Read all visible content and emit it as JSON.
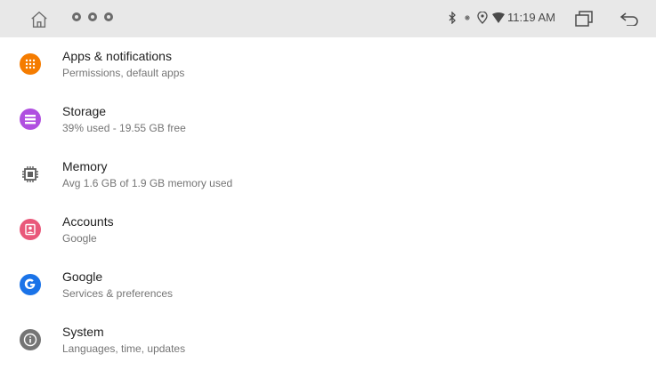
{
  "status_bar": {
    "time": "11:19 AM",
    "left_icons": [
      "home-icon",
      "notification-dot-icon",
      "notification-dot-icon",
      "notification-dot-icon"
    ],
    "right_icons": [
      "bluetooth-icon",
      "signal-icon",
      "location-icon",
      "wifi-icon",
      "recents-icon",
      "back-icon"
    ]
  },
  "settings_list": [
    {
      "title": "Apps & notifications",
      "subtitle": "Permissions, default apps",
      "icon": "apps-icon",
      "color": "#f57c00"
    },
    {
      "title": "Storage",
      "subtitle": "39% used - 19.55 GB free",
      "icon": "storage-icon",
      "color": "#b04fe0"
    },
    {
      "title": "Memory",
      "subtitle": "Avg 1.6 GB of 1.9 GB memory used",
      "icon": "memory-icon",
      "color": "#5f5f5f"
    },
    {
      "title": "Accounts",
      "subtitle": "Google",
      "icon": "accounts-icon",
      "color": "#e9587a"
    },
    {
      "title": "Google",
      "subtitle": "Services & preferences",
      "icon": "google-icon",
      "color": "#1a73e8"
    },
    {
      "title": "System",
      "subtitle": "Languages, time, updates",
      "icon": "system-icon",
      "color": "#757575"
    }
  ]
}
